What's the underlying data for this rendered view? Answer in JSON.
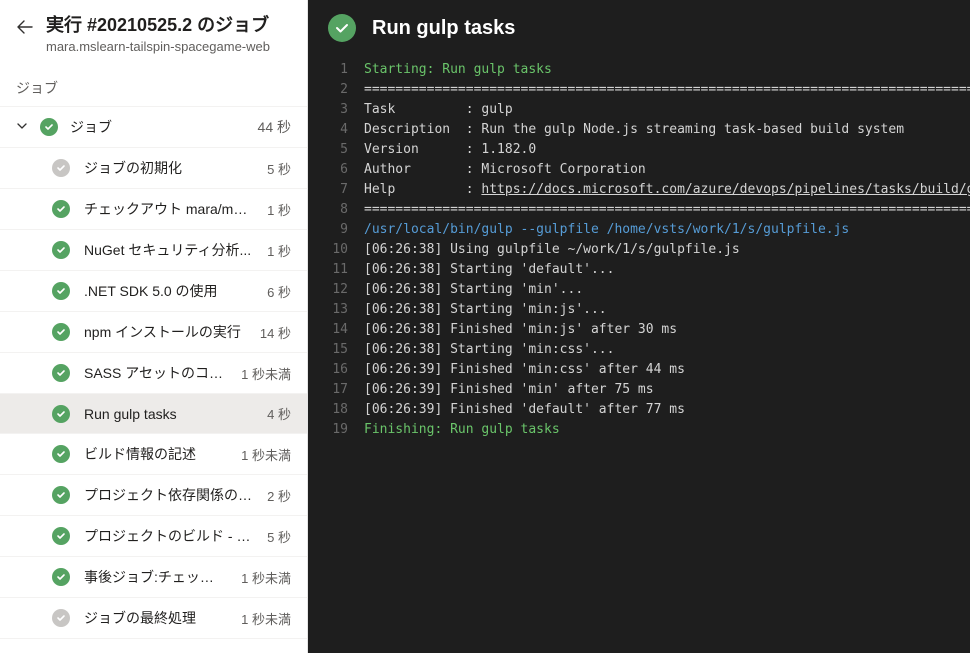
{
  "header": {
    "title": "実行 #20210525.2 のジョブ",
    "subtitle": "mara.mslearn-tailspin-spacegame-web"
  },
  "section_label": "ジョブ",
  "job_group": {
    "label": "ジョブ",
    "duration": "44 秒"
  },
  "tasks": [
    {
      "status": "neutral",
      "label": "ジョブの初期化",
      "duration": "5 秒",
      "selected": false
    },
    {
      "status": "success",
      "label": "チェックアウト mara/mslear...",
      "duration": "1 秒",
      "selected": false
    },
    {
      "status": "success",
      "label": "NuGet セキュリティ分析...",
      "duration": "1 秒",
      "selected": false
    },
    {
      "status": "success",
      "label": ".NET SDK 5.0 の使用",
      "duration": "6 秒",
      "selected": false
    },
    {
      "status": "success",
      "label": "npm インストールの実行",
      "duration": "14 秒",
      "selected": false
    },
    {
      "status": "success",
      "label": "SASS アセットのコン...",
      "duration": "1 秒未満",
      "selected": false
    },
    {
      "status": "success",
      "label": "Run gulp tasks",
      "duration": "4 秒",
      "selected": true
    },
    {
      "status": "success",
      "label": "ビルド情報の記述",
      "duration": "1 秒未満",
      "selected": false
    },
    {
      "status": "success",
      "label": "プロジェクト依存関係の復...",
      "duration": "2 秒",
      "selected": false
    },
    {
      "status": "success",
      "label": "プロジェクトのビルド - Rel...",
      "duration": "5 秒",
      "selected": false
    },
    {
      "status": "success",
      "label": "事後ジョブ:チェックア...",
      "duration": "1 秒未満",
      "selected": false
    },
    {
      "status": "neutral",
      "label": "ジョブの最終処理",
      "duration": "1 秒未満",
      "selected": false
    }
  ],
  "log_header": {
    "title": "Run gulp tasks"
  },
  "log_lines": [
    {
      "n": 1,
      "cls": "c-green",
      "text": "Starting: Run gulp tasks"
    },
    {
      "n": 2,
      "cls": "",
      "text": "=============================================================================="
    },
    {
      "n": 3,
      "cls": "",
      "text": "Task         : gulp"
    },
    {
      "n": 4,
      "cls": "",
      "text": "Description  : Run the gulp Node.js streaming task-based build system"
    },
    {
      "n": 5,
      "cls": "",
      "text": "Version      : 1.182.0"
    },
    {
      "n": 6,
      "cls": "",
      "text": "Author       : Microsoft Corporation"
    },
    {
      "n": 7,
      "cls": "",
      "prefix": "Help         : ",
      "link": "https://docs.microsoft.com/azure/devops/pipelines/tasks/build/gulp"
    },
    {
      "n": 8,
      "cls": "",
      "text": "=============================================================================="
    },
    {
      "n": 9,
      "cls": "c-blue",
      "text": "/usr/local/bin/gulp --gulpfile /home/vsts/work/1/s/gulpfile.js"
    },
    {
      "n": 10,
      "cls": "",
      "text": "[06:26:38] Using gulpfile ~/work/1/s/gulpfile.js"
    },
    {
      "n": 11,
      "cls": "",
      "text": "[06:26:38] Starting 'default'..."
    },
    {
      "n": 12,
      "cls": "",
      "text": "[06:26:38] Starting 'min'..."
    },
    {
      "n": 13,
      "cls": "",
      "text": "[06:26:38] Starting 'min:js'..."
    },
    {
      "n": 14,
      "cls": "",
      "text": "[06:26:38] Finished 'min:js' after 30 ms"
    },
    {
      "n": 15,
      "cls": "",
      "text": "[06:26:38] Starting 'min:css'..."
    },
    {
      "n": 16,
      "cls": "",
      "text": "[06:26:39] Finished 'min:css' after 44 ms"
    },
    {
      "n": 17,
      "cls": "",
      "text": "[06:26:39] Finished 'min' after 75 ms"
    },
    {
      "n": 18,
      "cls": "",
      "text": "[06:26:39] Finished 'default' after 77 ms"
    },
    {
      "n": 19,
      "cls": "c-green",
      "text": "Finishing: Run gulp tasks"
    }
  ]
}
